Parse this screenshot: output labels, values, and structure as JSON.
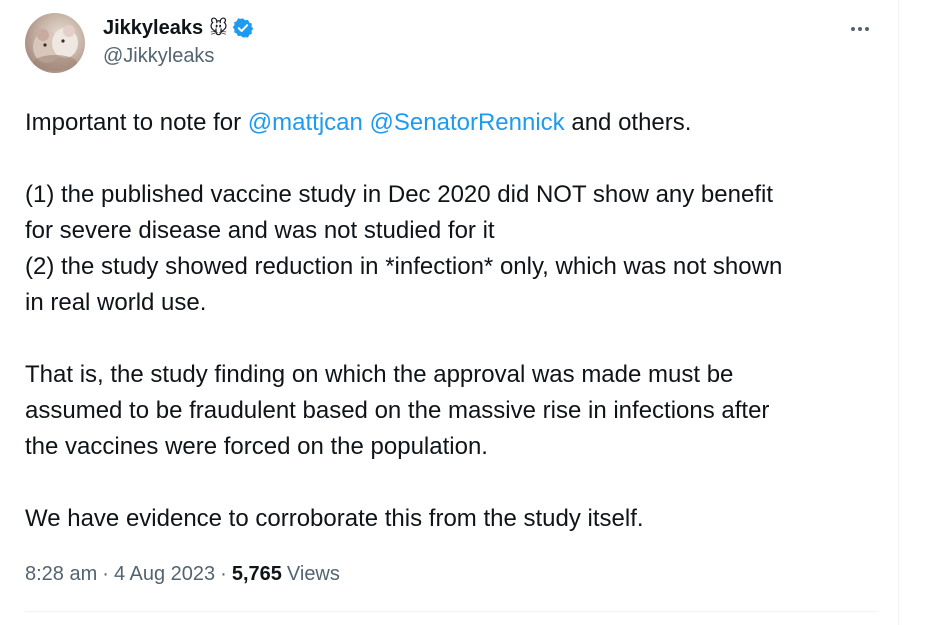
{
  "author": {
    "display_name": "Jikkyleaks",
    "name_emoji": "🐭",
    "handle": "@Jikkyleaks",
    "verified_color": "#1d9bf0"
  },
  "tweet": {
    "intro_before": "Important to note for ",
    "mention1": "@mattjcan",
    "mention2": "@SenatorRennick",
    "intro_after": " and others.",
    "p2_line1": "(1) the published vaccine study in Dec 2020 did NOT show any benefit",
    "p2_line2": "for severe disease and was not studied for it",
    "p2_line3": "(2) the study showed reduction in *infection* only, which was not shown",
    "p2_line4": "in real world use.",
    "p3_line1": "That is, the study finding on which the approval was made must be",
    "p3_line2": "assumed to be fraudulent based on the massive rise in infections after",
    "p3_line3": "the vaccines were forced on the population.",
    "p4_line1": "We have evidence to corroborate this from the study itself."
  },
  "meta": {
    "time": "8:28 am",
    "separator": "·",
    "date": "4 Aug 2023",
    "views_count": "5,765",
    "views_label": "Views"
  },
  "colors": {
    "link": "#1d9bf0",
    "secondary_text": "#536471",
    "primary_text": "#0f1419",
    "border": "#eff3f4"
  }
}
